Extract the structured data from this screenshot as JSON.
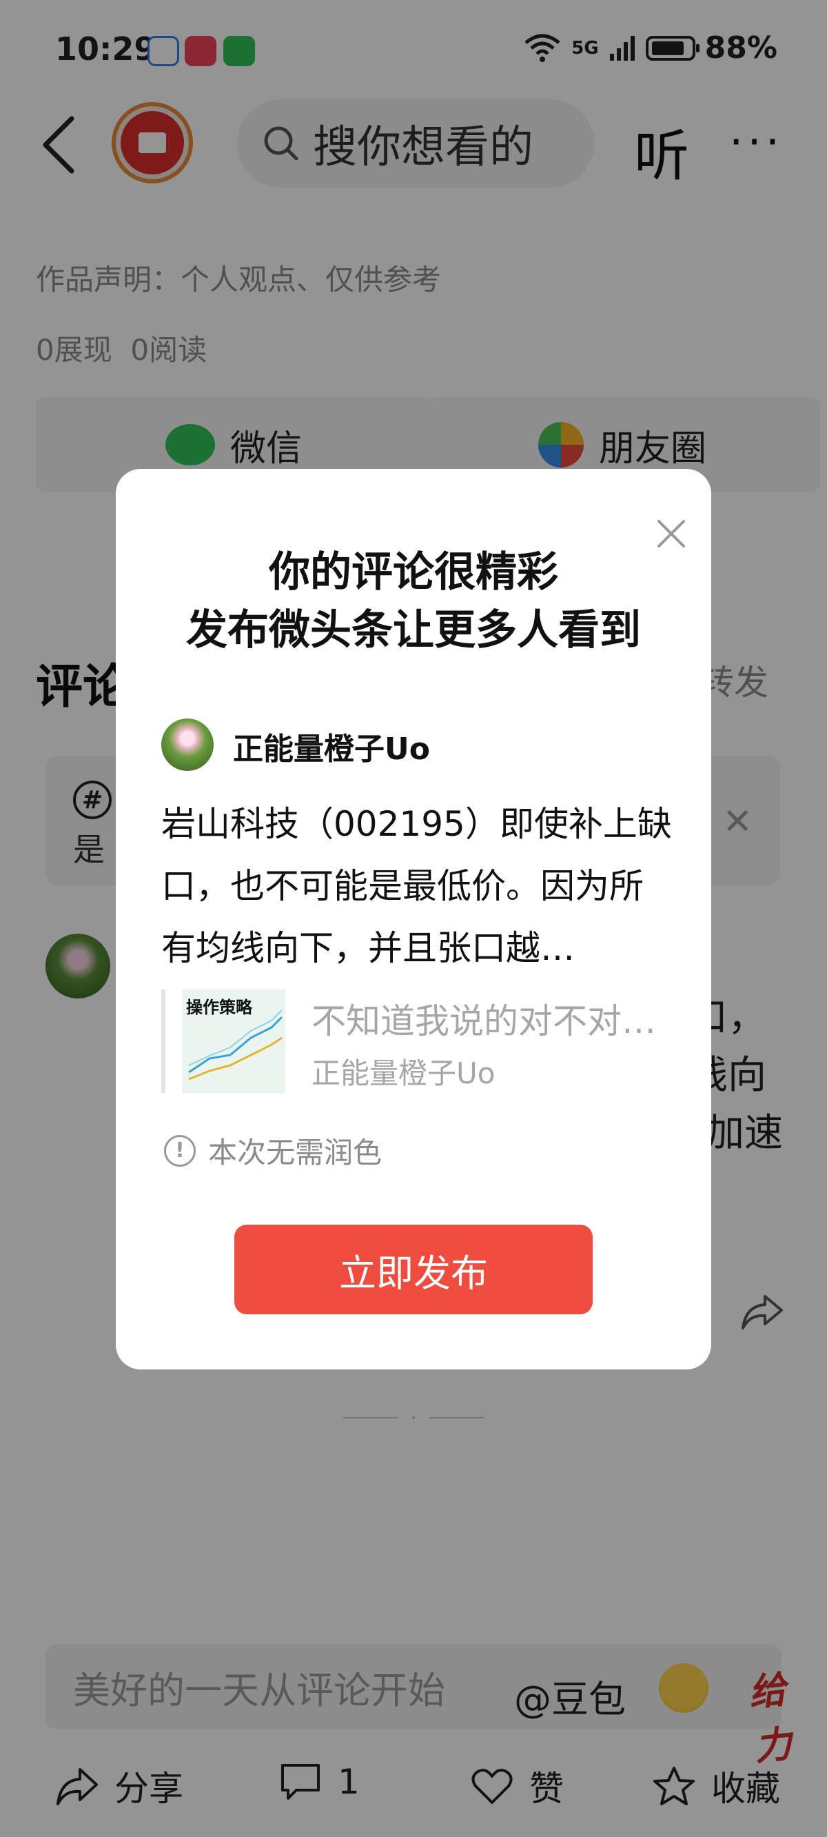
{
  "status_bar": {
    "time": "10:29",
    "network": "5G",
    "battery": "88%"
  },
  "nav": {
    "search_placeholder": "搜你想看的",
    "listen_label": "听",
    "more_label": "···"
  },
  "article_meta": {
    "statement": "作品声明：个人观点、仅供参考",
    "stats": "0展现  0阅读"
  },
  "share_targets": [
    {
      "label": "微信",
      "icon": "wechat-icon"
    },
    {
      "label": "朋友圈",
      "icon": "moments-icon"
    }
  ],
  "comments_section": {
    "heading": "评论",
    "forward_link": "转发",
    "topic_hash": "#",
    "topic_text": "是",
    "bg_comment_lines": [
      "口，",
      "线向",
      "加速"
    ]
  },
  "comment_input": {
    "placeholder": "美好的一天从评论开始",
    "mention": "@豆包",
    "sticker": "给力"
  },
  "bottom_bar": {
    "share": "分享",
    "comments_count": "1",
    "like": "赞",
    "favorite": "收藏"
  },
  "dialog": {
    "title_line1": "你的评论很精彩",
    "title_line2": "发布微头条让更多人看到",
    "user_name": "正能量橙子Uo",
    "comment_text": "岩山科技（002195）即使补上缺口，也不可能是最低价。因为所有均线向下，并且张口越…",
    "article": {
      "thumb_title": "操作策略",
      "title": "不知道我说的对不对…",
      "author": "正能量橙子Uo"
    },
    "polish_notice": "本次无需润色",
    "publish_button": "立即发布"
  },
  "colors": {
    "accent_red": "#ef4b3f",
    "overlay": "rgba(0,0,0,0.42)"
  }
}
